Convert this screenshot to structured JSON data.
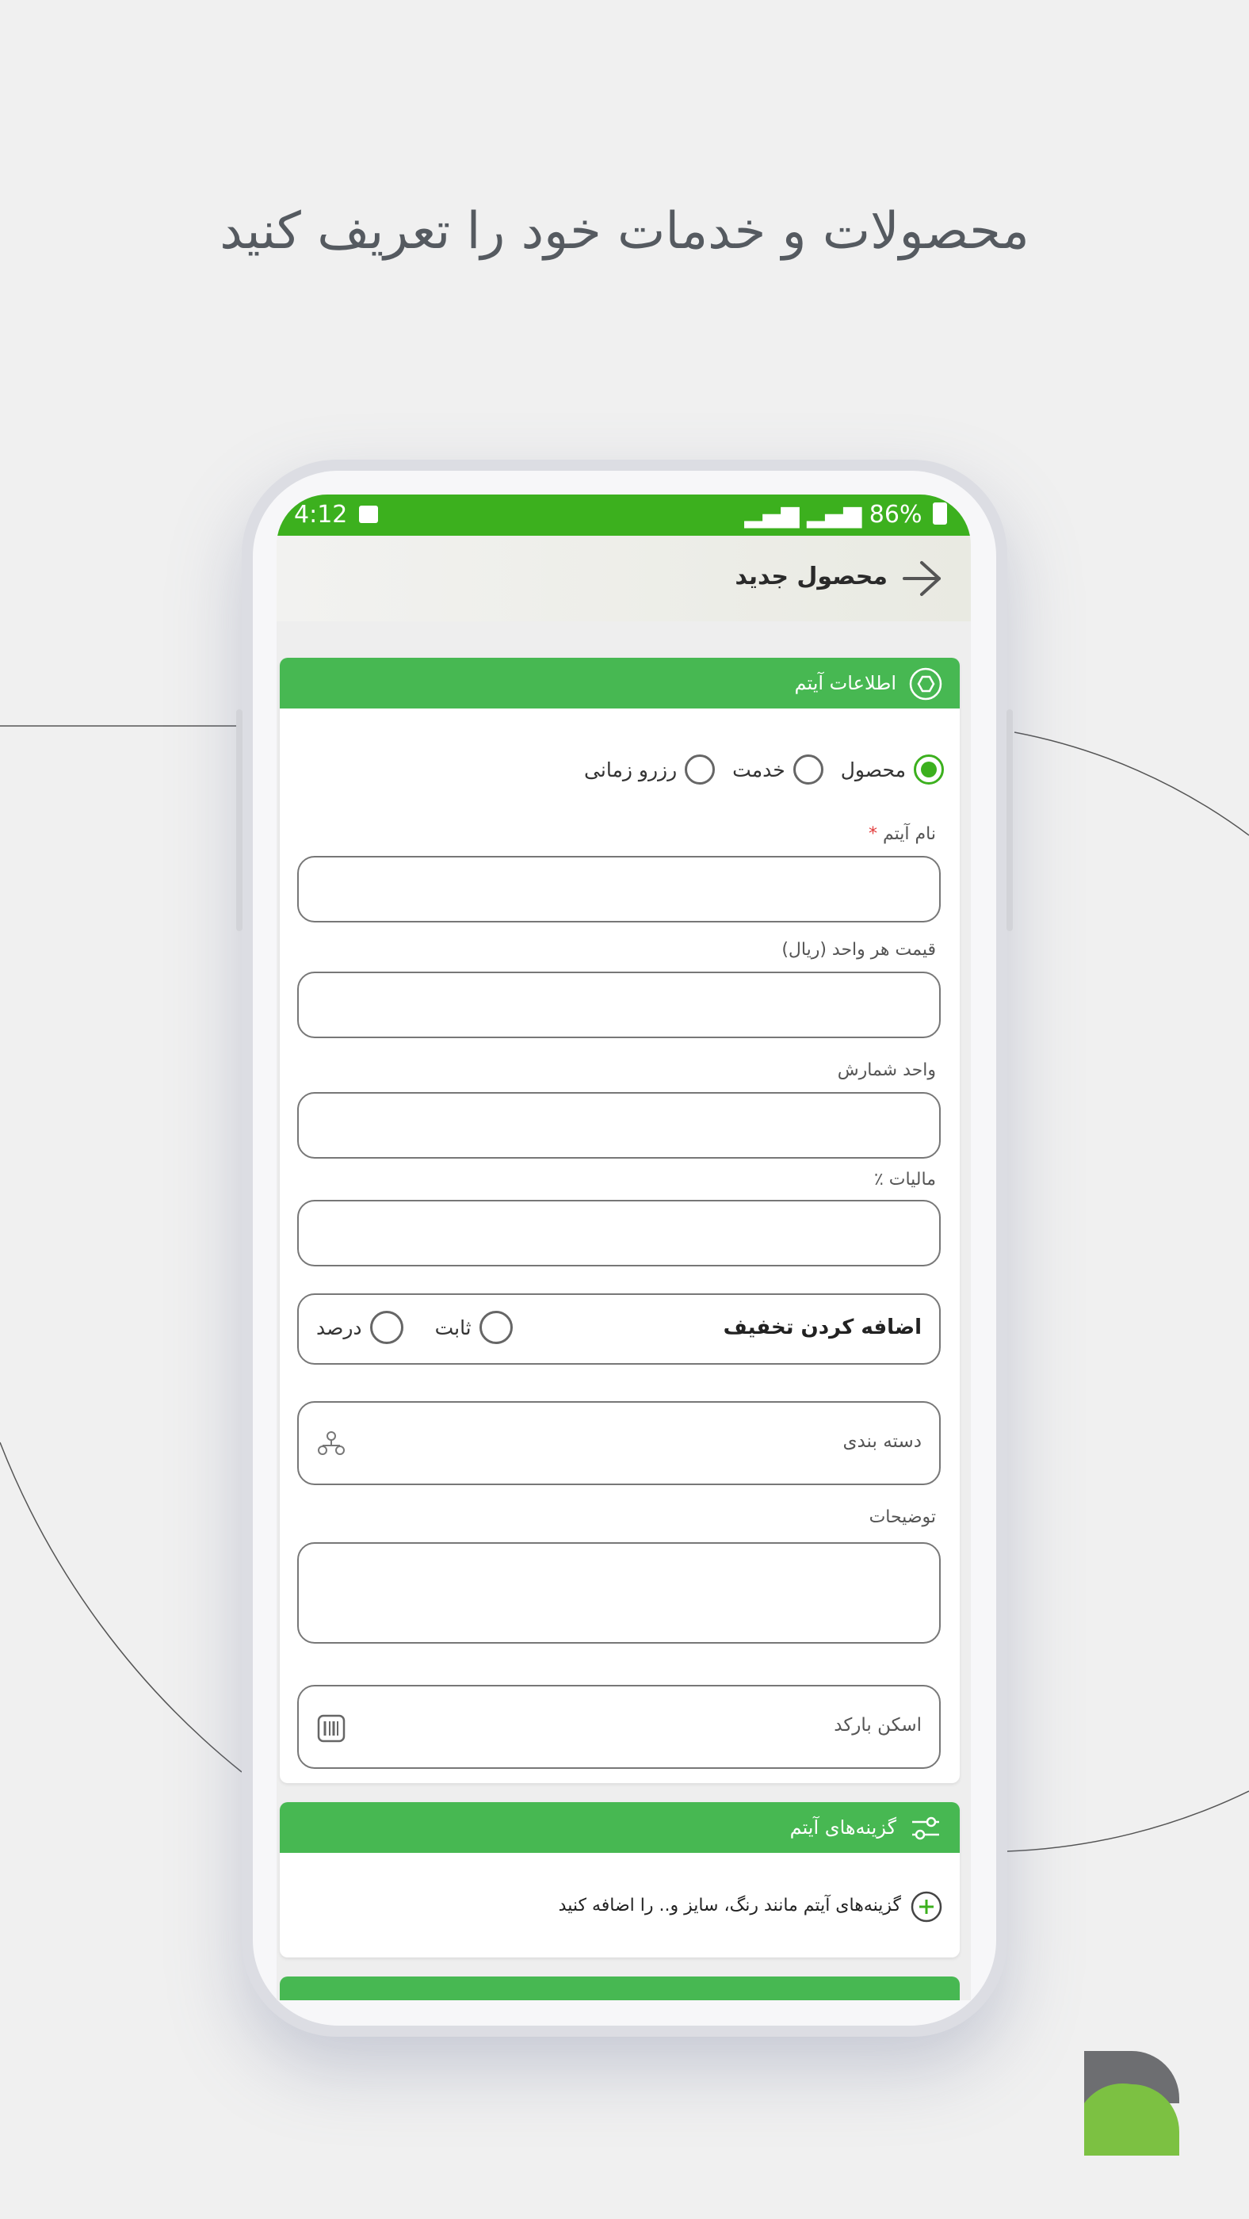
{
  "headline": "محصولات و خدمات خود را تعریف کنید",
  "status_bar": {
    "time": "4:12",
    "battery": "86%"
  },
  "app_bar": {
    "title": "محصول جدید"
  },
  "item_info": {
    "header": "اطلاعات آیتم",
    "type_options": [
      "محصول",
      "خدمت",
      "رزرو زمانی"
    ],
    "selected_type": "محصول",
    "name_label": "نام آیتم",
    "name_required_mark": "*",
    "price_label": "قیمت هر واحد (ریال)",
    "unit_label": "واحد شمارش",
    "tax_label": "مالیات ٪",
    "discount_title": "اضافه کردن تخفیف",
    "discount_options": [
      "ثابت",
      "درصد"
    ],
    "category_placeholder": "دسته بندی",
    "description_label": "توضیحات",
    "barcode_placeholder": "اسکن بارکد"
  },
  "item_options": {
    "header": "گزینه‌های آیتم",
    "add_text": "گزینه‌های آیتم مانند رنگ، سایز و.. را اضافه کنید"
  },
  "colors": {
    "status_green": "#3cb01e",
    "header_green": "#47b852",
    "logo_dark": "#6d6e71",
    "logo_green": "#7cc142"
  }
}
